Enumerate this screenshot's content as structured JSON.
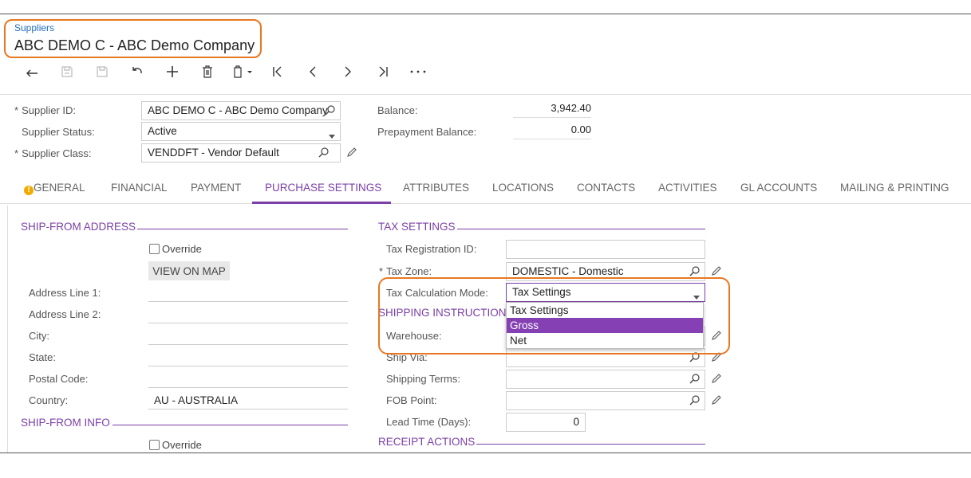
{
  "header": {
    "breadcrumb": "Suppliers",
    "title": "ABC DEMO C - ABC Demo Company"
  },
  "toolbar": {
    "buttons": [
      "back-icon",
      "save-icon",
      "save-close-icon",
      "undo-icon",
      "add-icon",
      "delete-icon",
      "copy-paste-icon",
      "first-icon",
      "prev-icon",
      "next-icon",
      "last-icon",
      "more-icon"
    ]
  },
  "summary": {
    "supplier_id_label": "Supplier ID:",
    "supplier_id_value": "ABC DEMO C - ABC Demo Company",
    "supplier_status_label": "Supplier Status:",
    "supplier_status_value": "Active",
    "supplier_class_label": "Supplier Class:",
    "supplier_class_value": "VENDDFT - Vendor Default",
    "balance_label": "Balance:",
    "balance_value": "3,942.40",
    "prepayment_label": "Prepayment Balance:",
    "prepayment_value": "0.00",
    "required_marker": "*"
  },
  "tabs": [
    {
      "label": "GENERAL"
    },
    {
      "label": "FINANCIAL"
    },
    {
      "label": "PAYMENT"
    },
    {
      "label": "PURCHASE SETTINGS"
    },
    {
      "label": "ATTRIBUTES"
    },
    {
      "label": "LOCATIONS"
    },
    {
      "label": "CONTACTS"
    },
    {
      "label": "ACTIVITIES"
    },
    {
      "label": "GL ACCOUNTS"
    },
    {
      "label": "MAILING & PRINTING"
    }
  ],
  "active_tab": "PURCHASE SETTINGS",
  "ship_from_address": {
    "section_title": "SHIP-FROM ADDRESS",
    "override_label": "Override",
    "view_on_map": "VIEW ON MAP",
    "address_line1_label": "Address Line 1:",
    "address_line2_label": "Address Line 2:",
    "city_label": "City:",
    "state_label": "State:",
    "postal_code_label": "Postal Code:",
    "country_label": "Country:",
    "country_value": "AU - AUSTRALIA"
  },
  "ship_from_info": {
    "section_title": "SHIP-FROM INFO",
    "override_label": "Override"
  },
  "tax_settings": {
    "section_title": "TAX SETTINGS",
    "tax_reg_label": "Tax Registration ID:",
    "tax_reg_value": "",
    "tax_zone_label": "Tax Zone:",
    "tax_zone_value": "DOMESTIC - Domestic",
    "tax_calc_label": "Tax Calculation Mode:",
    "tax_calc_value": "Tax Settings",
    "tax_calc_options": [
      "Tax Settings",
      "Gross",
      "Net"
    ],
    "tax_calc_highlighted": "Gross"
  },
  "shipping_instructions": {
    "section_title": "SHIPPING INSTRUCTIONS",
    "warehouse_label": "Warehouse:",
    "ship_via_label": "Ship Via:",
    "shipping_terms_label": "Shipping Terms:",
    "fob_point_label": "FOB Point:",
    "lead_time_label": "Lead Time (Days):",
    "lead_time_value": "0"
  },
  "receipt_actions": {
    "section_title": "RECEIPT ACTIONS"
  },
  "colors": {
    "accent": "#7b3fa7",
    "highlight": "#8541b3",
    "callout": "#e87722",
    "link": "#1f6fbf",
    "warning": "#f2a900"
  }
}
